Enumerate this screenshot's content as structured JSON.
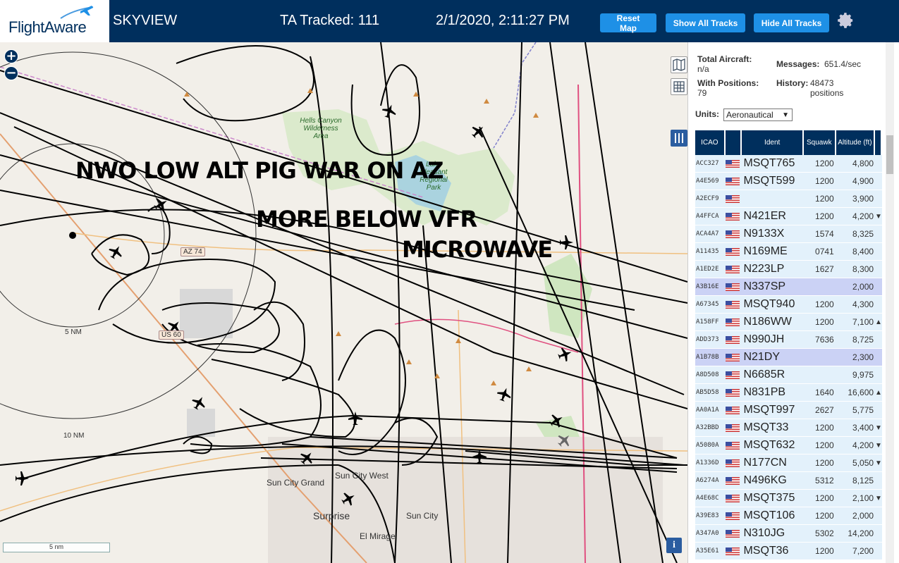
{
  "header": {
    "logo_text": "FlightAware",
    "app_title": "SKYVIEW",
    "tracked": "TA Tracked: 111",
    "datetime": "2/1/2020, 2:11:27 PM",
    "reset_label": "Reset Map",
    "show_label": "Show All Tracks",
    "hide_label": "Hide All Tracks",
    "settings_icon": "gear-icon",
    "accent": "#1e90e6",
    "bg": "#002f5d"
  },
  "map": {
    "overlay_1": "NWO LOW ALT PIG WAR ON AZ",
    "overlay_2": "MORE  BELOW VFR",
    "overlay_3": "MICROWAVE",
    "ring_5": "5 NM",
    "ring_10": "10 NM",
    "scale": "5 nm",
    "zoom_in": "+",
    "zoom_out": "−",
    "info": "i",
    "places": {
      "sun_city_grand": "Sun City Grand",
      "sun_city_west": "Sun City West",
      "surprise": "Surprise",
      "sun_city": "Sun City",
      "el_mirage": "El Mirage",
      "hells_canyon": "Hells Canyon Wilderness Area",
      "lake_pleasant": "Lake Pleasant Regional Park"
    },
    "highways": {
      "az74": "AZ 74",
      "us60": "US 60"
    }
  },
  "sidebar": {
    "total_label": "Total Aircraft:",
    "total_value": "n/a",
    "messages_label": "Messages:",
    "messages_value": "651.4/sec",
    "positions_label": "With Positions:",
    "positions_value": "79",
    "history_label": "History:",
    "history_value": "48473 positions",
    "units_label": "Units:",
    "units_value": "Aeronautical",
    "columns": [
      "ICAO",
      "",
      "Ident",
      "Squawk",
      "Altitude (ft)"
    ],
    "rows": [
      {
        "icao": "ACC327",
        "ident": "MSQT765",
        "squawk": "1200",
        "alt": "4,800",
        "trend": "",
        "sel": false
      },
      {
        "icao": "A4E569",
        "ident": "MSQT599",
        "squawk": "1200",
        "alt": "4,900",
        "trend": "",
        "sel": false
      },
      {
        "icao": "A2ECF9",
        "ident": "",
        "squawk": "1200",
        "alt": "3,900",
        "trend": "",
        "sel": false
      },
      {
        "icao": "A4FFCA",
        "ident": "N421ER",
        "squawk": "1200",
        "alt": "4,200",
        "trend": "▼",
        "sel": false
      },
      {
        "icao": "ACA4A7",
        "ident": "N9133X",
        "squawk": "1574",
        "alt": "8,325",
        "trend": "",
        "sel": false
      },
      {
        "icao": "A11435",
        "ident": "N169ME",
        "squawk": "0741",
        "alt": "8,400",
        "trend": "",
        "sel": false
      },
      {
        "icao": "A1ED2E",
        "ident": "N223LP",
        "squawk": "1627",
        "alt": "8,300",
        "trend": "",
        "sel": false
      },
      {
        "icao": "A3B16E",
        "ident": "N337SP",
        "squawk": "",
        "alt": "2,000",
        "trend": "",
        "sel": true
      },
      {
        "icao": "A67345",
        "ident": "MSQT940",
        "squawk": "1200",
        "alt": "4,300",
        "trend": "",
        "sel": false
      },
      {
        "icao": "A158FF",
        "ident": "N186WW",
        "squawk": "1200",
        "alt": "7,100",
        "trend": "▲",
        "sel": false
      },
      {
        "icao": "ADD373",
        "ident": "N990JH",
        "squawk": "7636",
        "alt": "8,725",
        "trend": "",
        "sel": false
      },
      {
        "icao": "A1B78B",
        "ident": "N21DY",
        "squawk": "",
        "alt": "2,300",
        "trend": "",
        "sel": true
      },
      {
        "icao": "A8D508",
        "ident": "N6685R",
        "squawk": "",
        "alt": "9,975",
        "trend": "",
        "sel": false
      },
      {
        "icao": "AB5D58",
        "ident": "N831PB",
        "squawk": "1640",
        "alt": "16,600",
        "trend": "▲",
        "sel": false
      },
      {
        "icao": "AA0A1A",
        "ident": "MSQT997",
        "squawk": "2627",
        "alt": "5,775",
        "trend": "",
        "sel": false
      },
      {
        "icao": "A32BBD",
        "ident": "MSQT33",
        "squawk": "1200",
        "alt": "3,400",
        "trend": "▼",
        "sel": false
      },
      {
        "icao": "A5080A",
        "ident": "MSQT632",
        "squawk": "1200",
        "alt": "4,200",
        "trend": "▼",
        "sel": false
      },
      {
        "icao": "A1336D",
        "ident": "N177CN",
        "squawk": "1200",
        "alt": "5,050",
        "trend": "▼",
        "sel": false
      },
      {
        "icao": "A6274A",
        "ident": "N496KG",
        "squawk": "5312",
        "alt": "8,125",
        "trend": "",
        "sel": false
      },
      {
        "icao": "A4E68C",
        "ident": "MSQT375",
        "squawk": "1200",
        "alt": "2,100",
        "trend": "▼",
        "sel": false
      },
      {
        "icao": "A39E83",
        "ident": "MSQT106",
        "squawk": "1200",
        "alt": "2,000",
        "trend": "",
        "sel": false
      },
      {
        "icao": "A347A0",
        "ident": "N310JG",
        "squawk": "5302",
        "alt": "14,200",
        "trend": "",
        "sel": false
      },
      {
        "icao": "A35E61",
        "ident": "MSQT36",
        "squawk": "1200",
        "alt": "7,200",
        "trend": "",
        "sel": false
      }
    ]
  }
}
